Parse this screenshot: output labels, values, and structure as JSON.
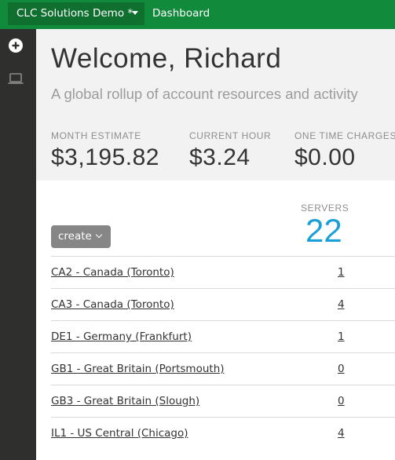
{
  "topbar": {
    "account_name": "CLC Solutions Demo *",
    "breadcrumb": "Dashboard"
  },
  "sidebar": {
    "items": [
      {
        "icon": "plus-circle-icon"
      },
      {
        "icon": "laptop-icon"
      }
    ]
  },
  "hero": {
    "title": "Welcome, Richard",
    "subtitle": "A global rollup of account resources and activity",
    "stats": [
      {
        "label": "MONTH ESTIMATE",
        "value": "$3,195.82"
      },
      {
        "label": "CURRENT HOUR",
        "value": "$3.24"
      },
      {
        "label": "ONE TIME CHARGES",
        "value": "$0.00"
      }
    ]
  },
  "resources": {
    "create_label": "create",
    "servers_label": "SERVERS",
    "servers_total": "22",
    "datacenters": [
      {
        "name": "CA2 - Canada (Toronto)",
        "servers": "1"
      },
      {
        "name": "CA3 - Canada (Toronto)",
        "servers": "4"
      },
      {
        "name": "DE1 - Germany (Frankfurt)",
        "servers": "1"
      },
      {
        "name": "GB1 - Great Britain (Portsmouth)",
        "servers": "0"
      },
      {
        "name": "GB3 - Great Britain (Slough)",
        "servers": "0"
      },
      {
        "name": "IL1 - US Central (Chicago)",
        "servers": "4"
      }
    ]
  },
  "colors": {
    "topbar": "#128a3b",
    "sidebar": "#2f302d",
    "accent": "#1aa0d8"
  }
}
